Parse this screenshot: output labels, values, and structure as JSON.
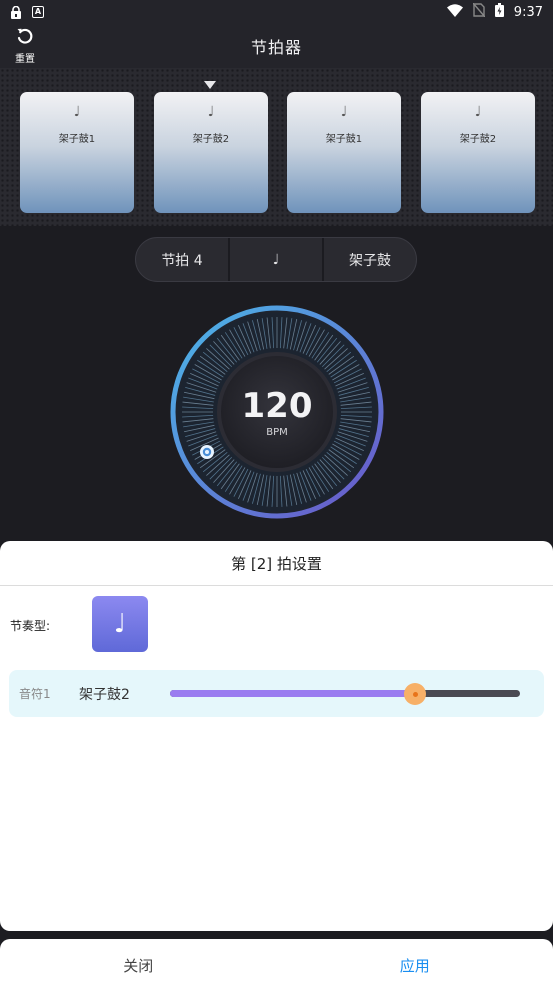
{
  "status_bar": {
    "time": "9:37",
    "left_icons": [
      "lock-icon",
      "a-icon"
    ],
    "right_icons": [
      "wifi-icon",
      "no-sim-icon",
      "battery-icon"
    ]
  },
  "header": {
    "reset_label": "重置",
    "title": "节拍器"
  },
  "beats": [
    {
      "note_symbol": "♩",
      "name": "架子鼓1"
    },
    {
      "note_symbol": "♩",
      "name": "架子鼓2"
    },
    {
      "note_symbol": "♩",
      "name": "架子鼓1"
    },
    {
      "note_symbol": "♩",
      "name": "架子鼓2"
    }
  ],
  "active_beat_index": 1,
  "controls": {
    "beats_label": "节拍 4",
    "note_symbol": "♩",
    "sound_label": "架子鼓"
  },
  "tempo": {
    "bpm": "120",
    "unit": "BPM"
  },
  "sheet": {
    "title": "第 [2] 拍设置",
    "rhythm_label": "节奏型:",
    "rhythm_symbol": "♩",
    "note_row": {
      "label": "音符1",
      "sound": "架子鼓2",
      "slider_fraction": 0.7
    }
  },
  "footer": {
    "close_label": "关闭",
    "apply_label": "应用"
  },
  "colors": {
    "accent_blue": "#1a8ef0",
    "slider_fill": "#9a7cf0",
    "slider_thumb": "#f7b067",
    "dial_ring": "#4aa8e0"
  }
}
